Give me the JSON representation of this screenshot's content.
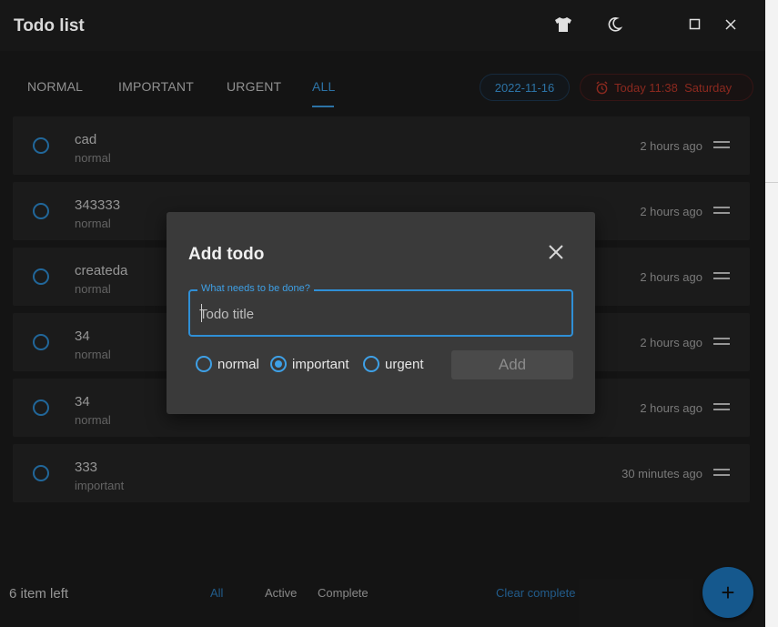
{
  "window": {
    "title": "Todo list"
  },
  "tabs": [
    {
      "label": "NORMAL",
      "active": false
    },
    {
      "label": "IMPORTANT",
      "active": false
    },
    {
      "label": "URGENT",
      "active": false
    },
    {
      "label": "ALL",
      "active": true
    }
  ],
  "date_chip": "2022-11-16",
  "time_chip": "Today 11:38  Saturday",
  "todos": [
    {
      "title": "cad",
      "priority": "normal",
      "time": "2 hours ago"
    },
    {
      "title": "343333",
      "priority": "normal",
      "time": "2 hours ago"
    },
    {
      "title": "createda",
      "priority": "normal",
      "time": "2 hours ago"
    },
    {
      "title": "34",
      "priority": "normal",
      "time": "2 hours ago"
    },
    {
      "title": "34",
      "priority": "normal",
      "time": "2 hours ago"
    },
    {
      "title": "333",
      "priority": "important",
      "time": "30 minutes ago"
    }
  ],
  "footer": {
    "items_left": "6 item left",
    "filters": [
      "All",
      "Active",
      "Complete"
    ],
    "active_filter": "All",
    "clear_label": "Clear complete",
    "fab_label": "+"
  },
  "dialog": {
    "title": "Add todo",
    "field_label": "What needs to be done?",
    "placeholder": "Todo title",
    "value": "",
    "options": [
      "normal",
      "important",
      "urgent"
    ],
    "selected_option": "important",
    "add_label": "Add"
  },
  "colors": {
    "accent": "#3ea0e6",
    "danger": "#c0392b",
    "background": "#1d1d1d"
  },
  "icons": {
    "titlebar": [
      "shirt-icon",
      "moon-icon",
      "maximize-icon",
      "close-icon"
    ]
  }
}
